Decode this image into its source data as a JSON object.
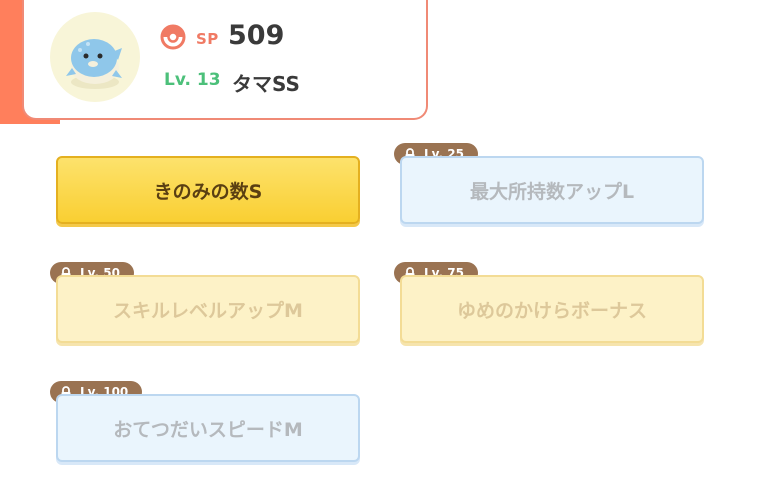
{
  "header": {
    "sp_label": "SP",
    "sp_value": "509",
    "level": "Lv. 13",
    "name": "タマSS",
    "avatar_icon": "spheal-avatar-icon",
    "sp_icon": "pokeball-icon"
  },
  "skills": [
    {
      "label": "きのみの数S",
      "state": "active",
      "lock": ""
    },
    {
      "label": "最大所持数アップL",
      "state": "locked",
      "lock": "Lv. 25"
    },
    {
      "label": "スキルレベルアップM",
      "state": "locked",
      "lock": "Lv. 50"
    },
    {
      "label": "ゆめのかけらボーナス",
      "state": "locked",
      "lock": "Lv. 75"
    },
    {
      "label": "おてつだいスピードM",
      "state": "locked",
      "lock": "Lv. 100"
    }
  ],
  "colors": {
    "accent": "#ff7f5c",
    "active_fill": "#f9cf32",
    "lock_tag": "#9a7352",
    "level_green": "#4cc07a"
  }
}
